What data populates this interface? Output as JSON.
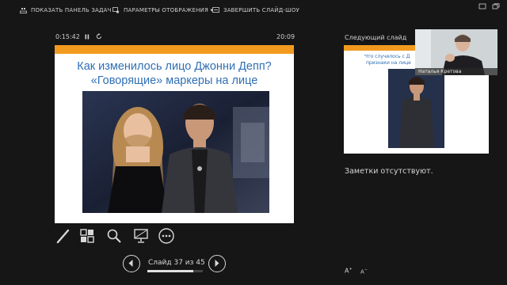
{
  "toolbar": {
    "show_taskbar": "ПОКАЗАТЬ ПАНЕЛЬ ЗАДАЧ",
    "display_settings": "ПАРАМЕТРЫ ОТОБРАЖЕНИЯ ▾",
    "end_show": "ЗАВЕРШИТЬ СЛАЙД-ШОУ"
  },
  "timer": {
    "elapsed": "0:15:42",
    "clock": "20:09"
  },
  "slide": {
    "title_line1": "Как изменилось лицо Джонни Депп?",
    "title_line2": "«Говорящие» маркеры на лице",
    "accent_color": "#f29a1f",
    "title_color": "#2f6fb3"
  },
  "next_slide": {
    "label": "Следующий слайд",
    "text_line1": "Что случилось с Д",
    "text_line2": "признаки на лице"
  },
  "webcam": {
    "name": "Наталья Кретова"
  },
  "notes": {
    "text": "Заметки отсутствуют."
  },
  "font_controls": {
    "increase": "A",
    "decrease": "A"
  },
  "tools": [
    "pen-icon",
    "slides-grid-icon",
    "zoom-icon",
    "screen-icon",
    "more-icon"
  ],
  "navigation": {
    "counter": "Слайд 37 из 45",
    "current": 37,
    "total": 45
  }
}
